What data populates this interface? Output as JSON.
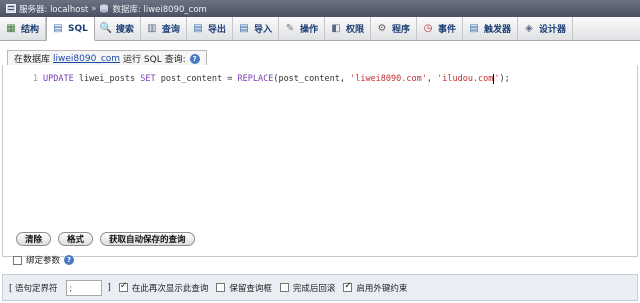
{
  "breadcrumb": {
    "server_label": "服务器: localhost",
    "separator": "»",
    "database_label": "数据库: liwei8090_com"
  },
  "tabs": [
    {
      "label": "结构",
      "icon": "structure-icon",
      "glyph": "▦",
      "color": "#3a7a3a"
    },
    {
      "label": "SQL",
      "icon": "sql-icon",
      "glyph": "▤",
      "color": "#3d6fb0",
      "active": true
    },
    {
      "label": "搜索",
      "icon": "search-icon",
      "glyph": "🔍",
      "color": "#555"
    },
    {
      "label": "查询",
      "icon": "query-icon",
      "glyph": "▥",
      "color": "#5a6a80"
    },
    {
      "label": "导出",
      "icon": "export-icon",
      "glyph": "▤",
      "color": "#3d6fb0"
    },
    {
      "label": "导入",
      "icon": "import-icon",
      "glyph": "▤",
      "color": "#3d6fb0"
    },
    {
      "label": "操作",
      "icon": "wrench-icon",
      "glyph": "✎",
      "color": "#777"
    },
    {
      "label": "权限",
      "icon": "privileges-icon",
      "glyph": "◧",
      "color": "#5a6a80"
    },
    {
      "label": "程序",
      "icon": "routines-icon",
      "glyph": "⚙",
      "color": "#666"
    },
    {
      "label": "事件",
      "icon": "events-icon",
      "glyph": "◷",
      "color": "#c03030"
    },
    {
      "label": "触发器",
      "icon": "triggers-icon",
      "glyph": "▤",
      "color": "#3d6fb0"
    },
    {
      "label": "设计器",
      "icon": "designer-icon",
      "glyph": "◈",
      "color": "#5a6a80"
    }
  ],
  "query": {
    "prefix": "在数据库",
    "database": "liwei8090_com",
    "suffix": "运行 SQL 查询:",
    "line_number": "1",
    "sql": {
      "kw1": "UPDATE",
      "p1": " liwei_posts ",
      "kw2": "SET",
      "p2": " post_content = ",
      "fn": "REPLACE",
      "p3": "(post_content, ",
      "s1": "'liwei8090.com'",
      "p4": ", ",
      "s2a": "'iludou.com",
      "s2b": "'",
      "p5": ");"
    }
  },
  "buttons": {
    "clear": "清除",
    "format": "格式",
    "get_autosaved": "获取自动保存的查询"
  },
  "bind_params": {
    "label": "绑定参数",
    "checked": false
  },
  "footer": {
    "delimiter_label": "[ 语句定界符",
    "delimiter_value": ";",
    "delimiter_close": "]",
    "options": [
      {
        "label": "在此再次显示此查询",
        "checked": true
      },
      {
        "label": "保留查询框",
        "checked": false
      },
      {
        "label": "完成后回滚",
        "checked": false
      },
      {
        "label": "启用外键约束",
        "checked": true
      }
    ]
  },
  "colors": {
    "topbar": "#5a6070",
    "tab_text": "#1c3e74",
    "keyword": "#7a3ab5",
    "string": "#c23030",
    "footer_bg": "#eaeef4"
  }
}
